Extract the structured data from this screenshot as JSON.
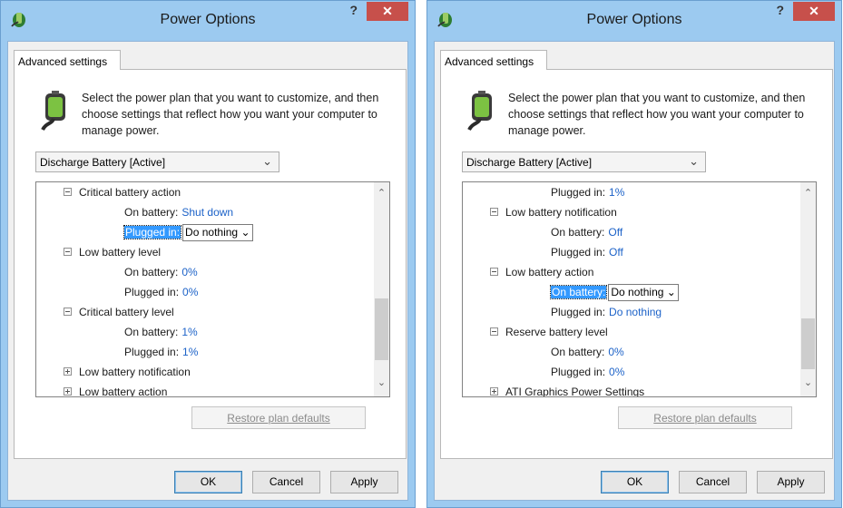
{
  "windows": [
    {
      "title": "Power Options",
      "help_label": "?",
      "close_label": "✕",
      "tab_label": "Advanced settings",
      "description": "Select the power plan that you want to customize, and then choose settings that reflect how you want your computer to manage power.",
      "plan_select": "Discharge Battery [Active]",
      "tree": {
        "critical_action": "Critical battery action",
        "critical_action_on_battery_label": "On battery:",
        "critical_action_on_battery_value": "Shut down",
        "critical_action_plugged_label": "Plugged in:",
        "critical_action_plugged_value": "Do nothing",
        "low_level": "Low battery level",
        "low_level_on_battery_label": "On battery:",
        "low_level_on_battery_value": "0%",
        "low_level_plugged_label": "Plugged in:",
        "low_level_plugged_value": "0%",
        "critical_level": "Critical battery level",
        "critical_level_on_battery_label": "On battery:",
        "critical_level_on_battery_value": "1%",
        "critical_level_plugged_label": "Plugged in:",
        "critical_level_plugged_value": "1%",
        "low_notification": "Low battery notification",
        "low_action": "Low battery action"
      },
      "restore_label": "Restore plan defaults",
      "ok_label": "OK",
      "cancel_label": "Cancel",
      "apply_label": "Apply"
    },
    {
      "title": "Power Options",
      "help_label": "?",
      "close_label": "✕",
      "tab_label": "Advanced settings",
      "description": "Select the power plan that you want to customize, and then choose settings that reflect how you want your computer to manage power.",
      "plan_select": "Discharge Battery [Active]",
      "tree": {
        "critical_level_plugged_label": "Plugged in:",
        "critical_level_plugged_value": "1%",
        "low_notification": "Low battery notification",
        "low_notification_on_battery_label": "On battery:",
        "low_notification_on_battery_value": "Off",
        "low_notification_plugged_label": "Plugged in:",
        "low_notification_plugged_value": "Off",
        "low_action": "Low battery action",
        "low_action_on_battery_label": "On battery:",
        "low_action_on_battery_value": "Do nothing",
        "low_action_plugged_label": "Plugged in:",
        "low_action_plugged_value": "Do nothing",
        "reserve_level": "Reserve battery level",
        "reserve_level_on_battery_label": "On battery:",
        "reserve_level_on_battery_value": "0%",
        "reserve_level_plugged_label": "Plugged in:",
        "reserve_level_plugged_value": "0%",
        "ati_graphics": "ATI Graphics Power Settings"
      },
      "restore_label": "Restore plan defaults",
      "ok_label": "OK",
      "cancel_label": "Cancel",
      "apply_label": "Apply"
    }
  ],
  "colors": {
    "frame": "#9ccaf0",
    "close_button": "#c7504b",
    "value_link": "#1c62c8",
    "selection": "#3399ff"
  },
  "icons": {
    "app": "power-plug-icon",
    "plan": "battery-plug-icon",
    "expander_open": "minus-box-icon",
    "expander_closed": "plus-box-icon"
  }
}
